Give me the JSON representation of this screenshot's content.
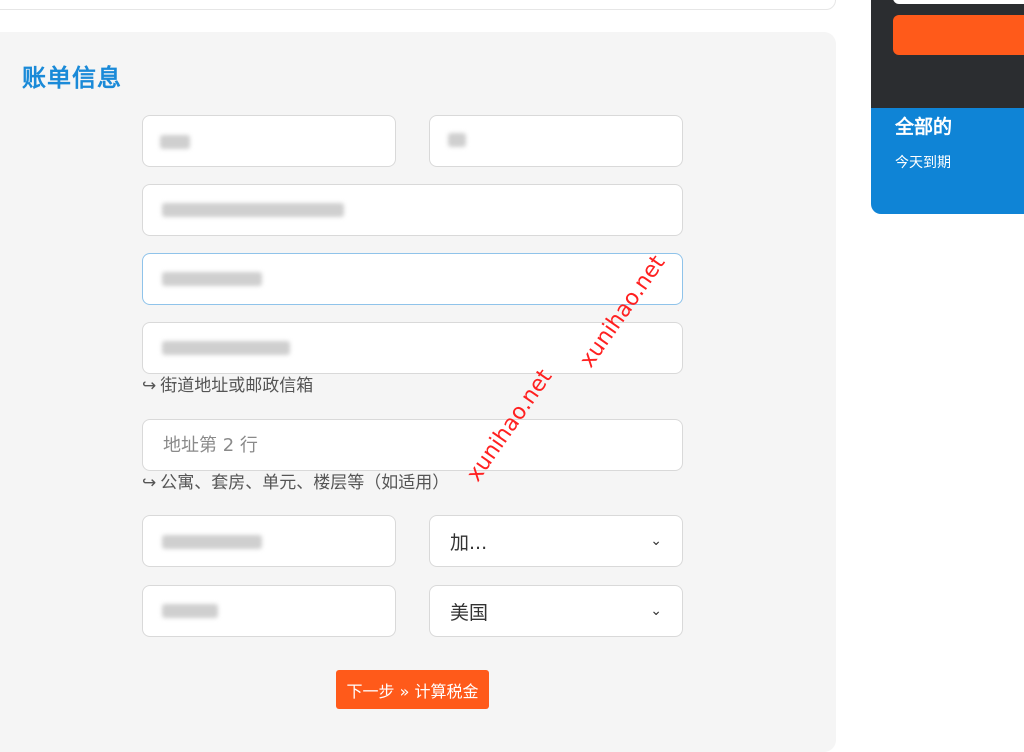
{
  "billing": {
    "title": "账单信息",
    "fields": {
      "first_name": {
        "value": "",
        "placeholder": ""
      },
      "last_name": {
        "value": "",
        "placeholder": ""
      },
      "email": {
        "value": "",
        "placeholder": ""
      },
      "phone": {
        "value": "",
        "placeholder": ""
      },
      "address1": {
        "value": "",
        "placeholder": "",
        "help": "街道地址或邮政信箱"
      },
      "address2": {
        "value": "",
        "placeholder": "地址第 2 行",
        "help": "公寓、套房、单元、楼层等（如适用）"
      },
      "city": {
        "value": "",
        "placeholder": ""
      },
      "state": {
        "selected": "加..."
      },
      "zip": {
        "value": "",
        "placeholder": ""
      },
      "country": {
        "selected": "美国"
      }
    },
    "help_arrow": "↪",
    "chevron": "⌄",
    "next_button": "下一步 » 计算税金"
  },
  "sidebar": {
    "section_title": "全部的",
    "section_sub": "今天到期"
  },
  "watermark": {
    "text": "xunihao.net"
  },
  "colors": {
    "accent": "#ff5a1a",
    "title_blue": "#1a8ad8",
    "sidebar_blue": "#0f84d6",
    "sidebar_dark": "#2b2d30"
  },
  "icons": [
    "chevron-down-icon",
    "return-arrow-icon"
  ]
}
